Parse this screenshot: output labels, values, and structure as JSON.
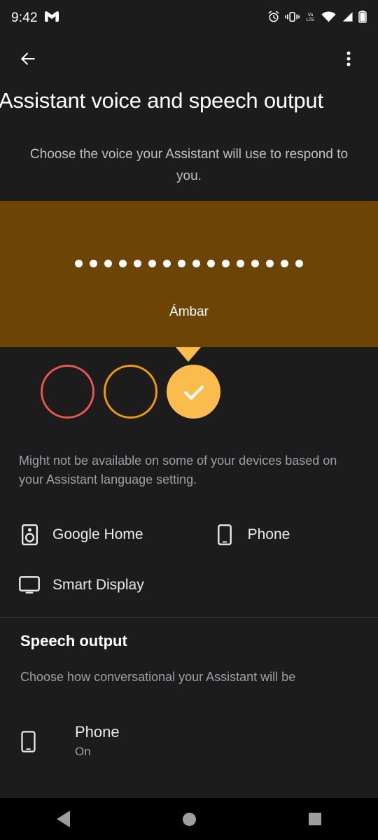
{
  "status_bar": {
    "time": "9:42",
    "left_icons": [
      {
        "name": "gmail-icon"
      }
    ],
    "right_icons": [
      {
        "name": "alarm-icon"
      },
      {
        "name": "vibrate-icon"
      },
      {
        "name": "volte-icon",
        "label_top": "Vo",
        "label_bottom": "LTE"
      },
      {
        "name": "wifi-icon"
      },
      {
        "name": "cell-signal-icon"
      },
      {
        "name": "battery-icon"
      }
    ]
  },
  "app_bar": {
    "back_label": "Back",
    "overflow_label": "More options"
  },
  "page": {
    "title": "Assistant voice and speech output",
    "subtitle": "Choose the voice your Assistant will use to respond to you."
  },
  "voice_preview": {
    "name": "Ámbar",
    "band_color": "#6b4406",
    "dot_count": 16,
    "dot_color": "#ffffff",
    "pointer_color": "#fbbc4e"
  },
  "voice_swatches": [
    {
      "name": "voice-swatch-red",
      "color": "#e5584a",
      "selected": false
    },
    {
      "name": "voice-swatch-orange",
      "color": "#f29900",
      "selected": false
    },
    {
      "name": "voice-swatch-amber",
      "color": "#fbbc4e",
      "selected": true
    }
  ],
  "availability_note": "Might not be available on some of your devices based on your Assistant language setting.",
  "devices": [
    {
      "icon": "speaker-icon",
      "label": "Google Home"
    },
    {
      "icon": "phone-icon",
      "label": "Phone"
    },
    {
      "icon": "smart-display-icon",
      "label": "Smart Display"
    }
  ],
  "speech_output": {
    "title": "Speech output",
    "description": "Choose how conversational your Assistant will be",
    "items": [
      {
        "icon": "phone-icon",
        "title": "Phone",
        "subtitle": "On"
      }
    ]
  },
  "nav_bar": {
    "back": "Back",
    "home": "Home",
    "recents": "Recent apps"
  }
}
